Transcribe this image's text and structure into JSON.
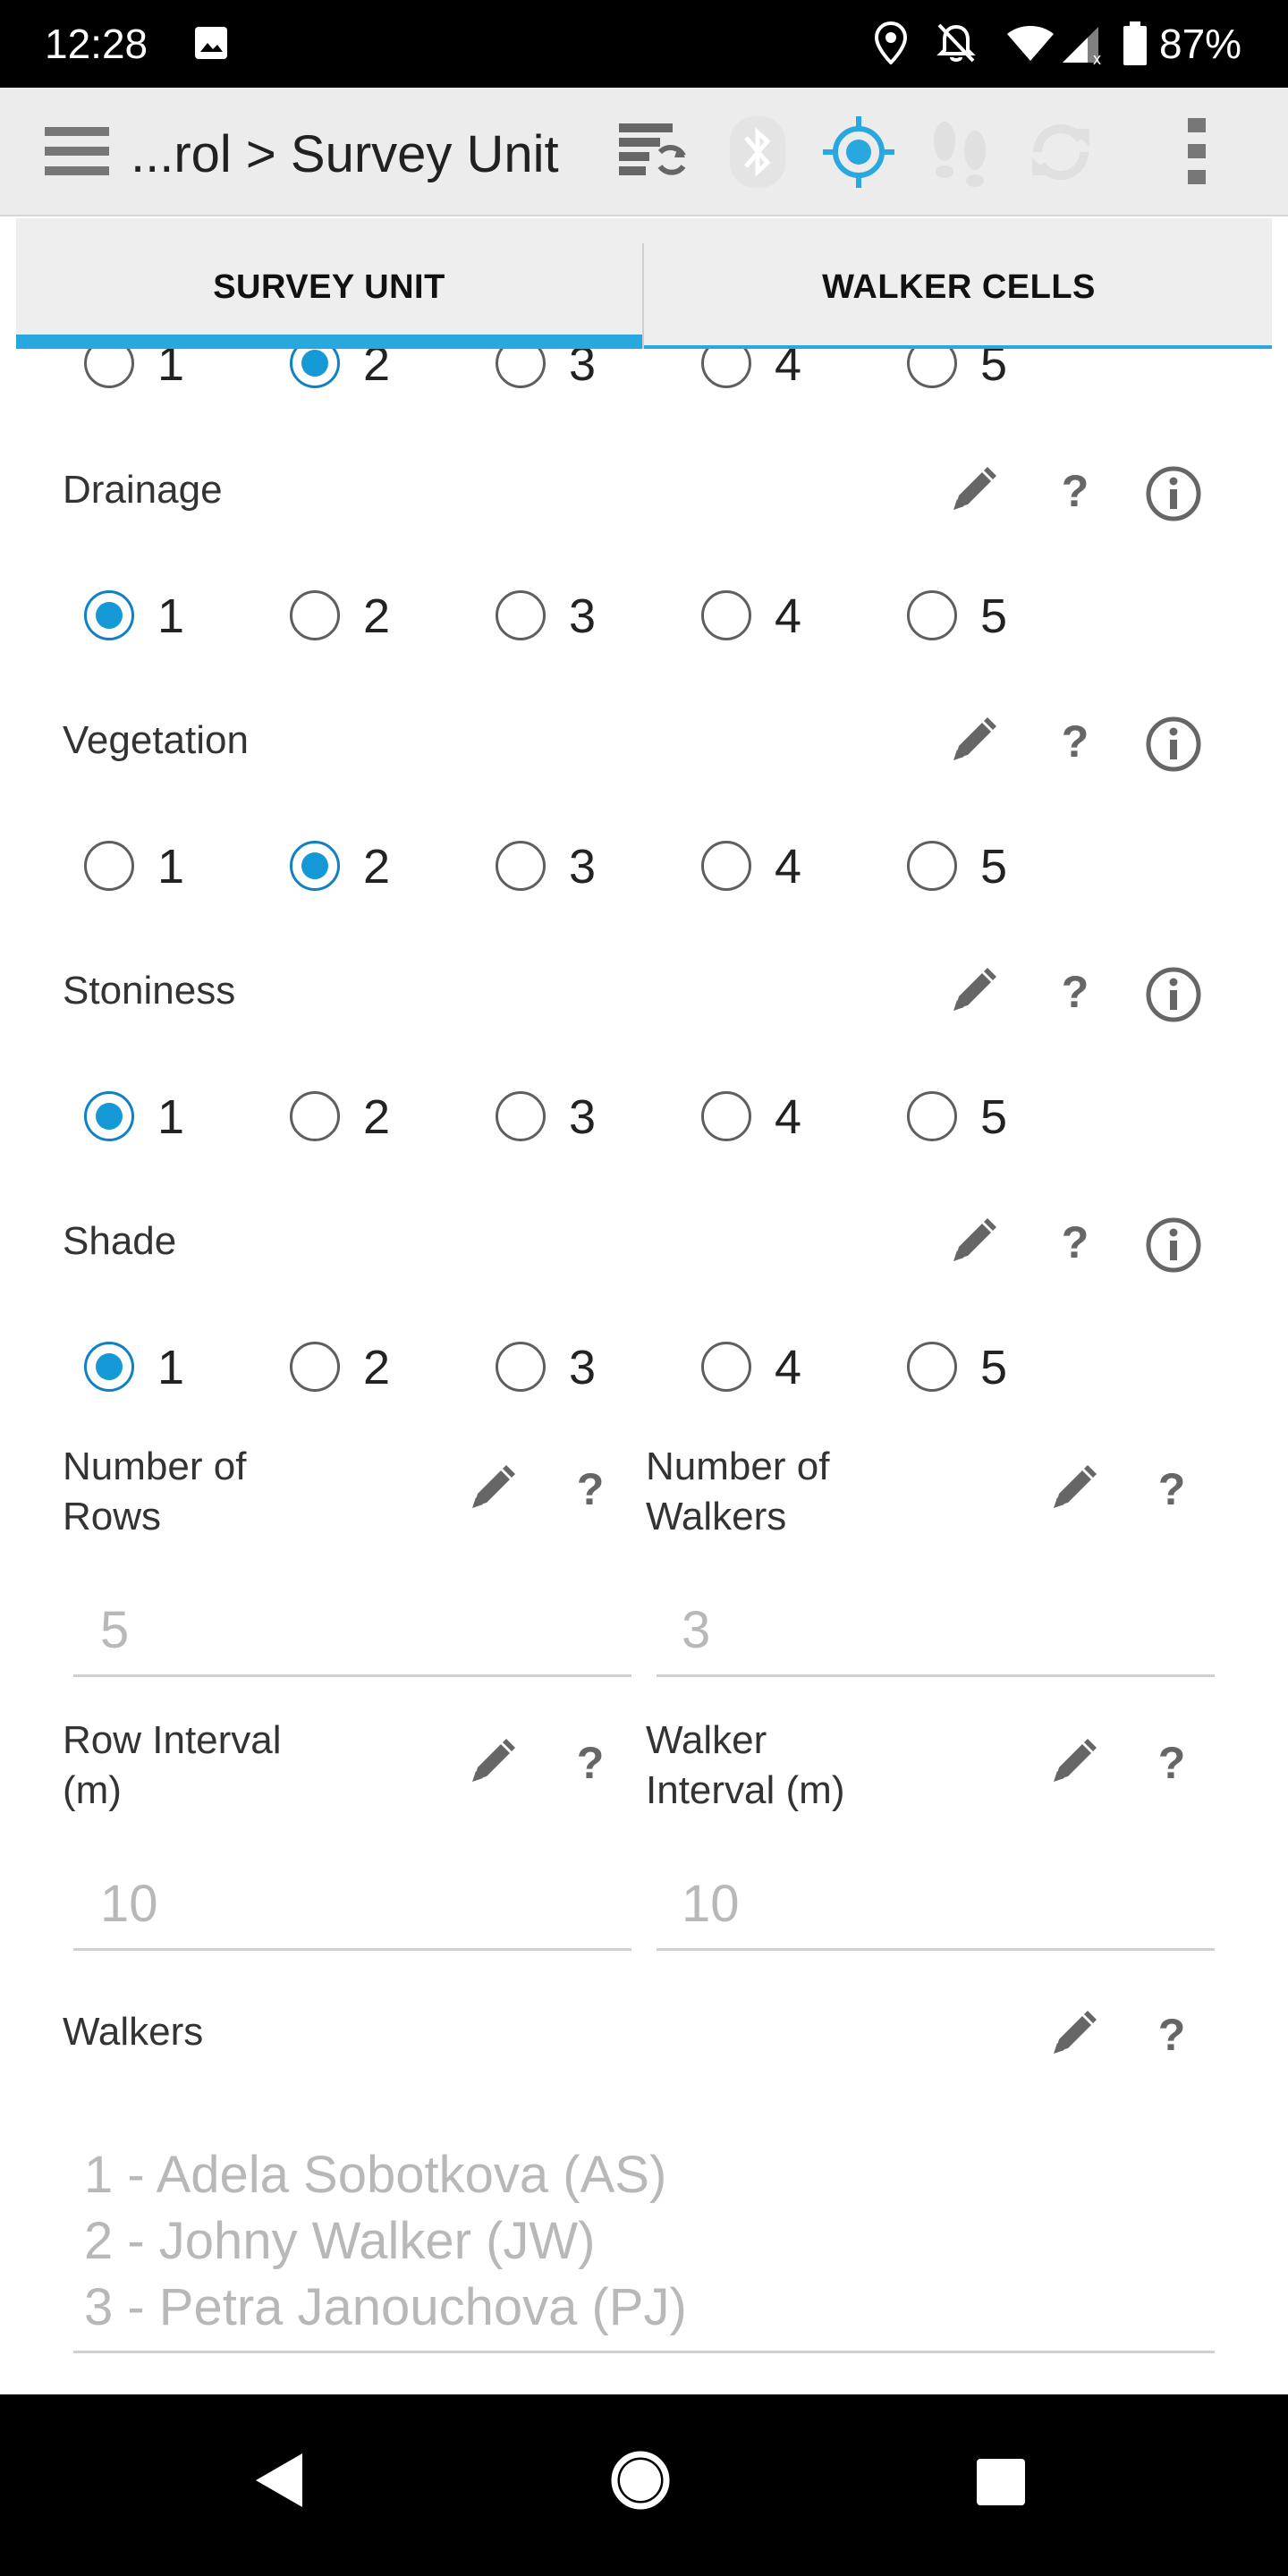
{
  "status_bar": {
    "time": "12:28",
    "battery": "87%",
    "icons": [
      "image-notification-icon",
      "location-icon",
      "bell-off-icon",
      "wifi-icon",
      "cell-signal-icon",
      "battery-icon"
    ]
  },
  "app_bar": {
    "title": "...rol > Survey Unit",
    "icons": [
      "menu-icon",
      "sync-icon",
      "bluetooth-icon",
      "gps-icon",
      "track-icon",
      "refresh-icon",
      "overflow-menu-icon"
    ],
    "accent_color": "#29a8e0"
  },
  "tabs": [
    {
      "label": "SURVEY UNIT",
      "active": true
    },
    {
      "label": "WALKER CELLS",
      "active": false
    }
  ],
  "scale_fields": [
    {
      "label": "",
      "options": [
        "1",
        "2",
        "3",
        "4",
        "5"
      ],
      "selected": "2"
    },
    {
      "label": "Drainage",
      "options": [
        "1",
        "2",
        "3",
        "4",
        "5"
      ],
      "selected": "1"
    },
    {
      "label": "Vegetation",
      "options": [
        "1",
        "2",
        "3",
        "4",
        "5"
      ],
      "selected": "2"
    },
    {
      "label": "Stoniness",
      "options": [
        "1",
        "2",
        "3",
        "4",
        "5"
      ],
      "selected": "1"
    },
    {
      "label": "Shade",
      "options": [
        "1",
        "2",
        "3",
        "4",
        "5"
      ],
      "selected": "1"
    }
  ],
  "number_fields": {
    "rows": {
      "label_line1": "Number of",
      "label_line2": "Rows",
      "value": "5"
    },
    "walkers": {
      "label_line1": "Number of",
      "label_line2": "Walkers",
      "value": "3"
    },
    "row_interval": {
      "label_line1": "Row Interval",
      "label_line2": "(m)",
      "value": "10"
    },
    "walker_interval": {
      "label_line1": "Walker",
      "label_line2": "Interval (m)",
      "value": "10"
    }
  },
  "walkers_field": {
    "label": "Walkers",
    "entries": [
      "1 - Adela Sobotkova (AS)",
      "2 - Johny Walker (JW)",
      "3 - Petra Janouchova (PJ)"
    ]
  },
  "nav_bar": {
    "icons": [
      "back-icon",
      "home-icon",
      "recents-icon"
    ]
  }
}
